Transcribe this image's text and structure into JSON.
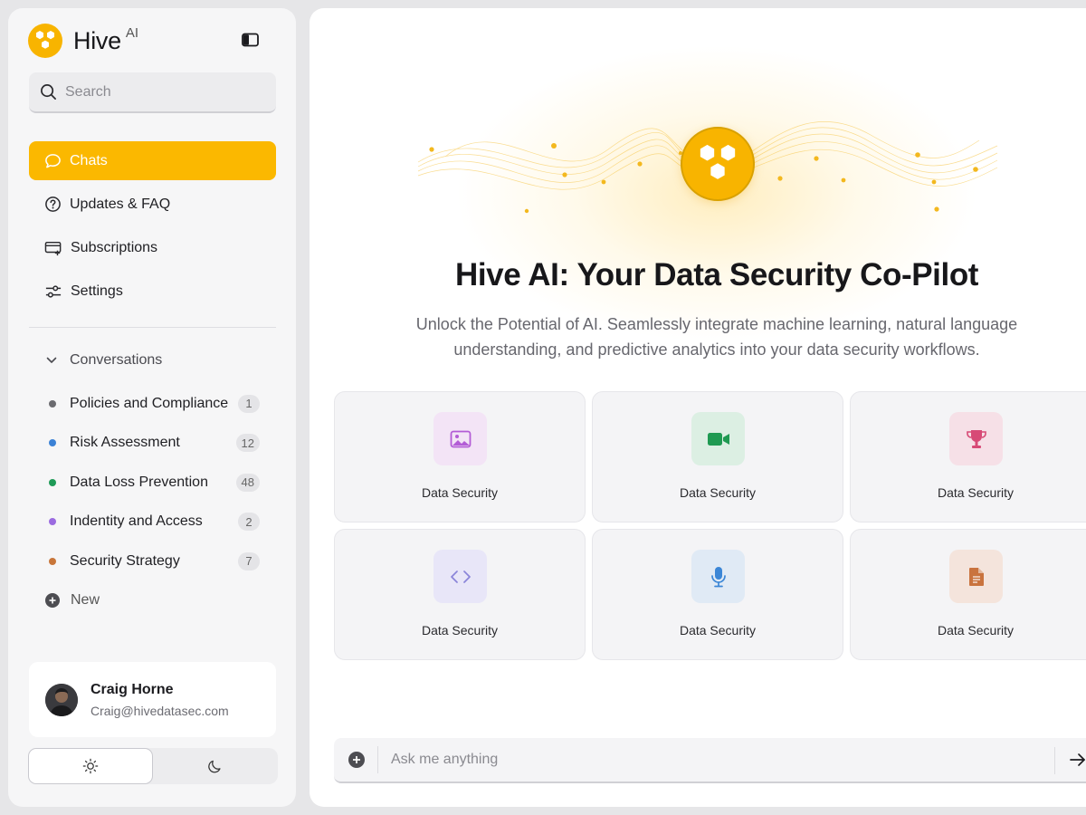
{
  "brand": {
    "name": "Hive",
    "sup": "AI"
  },
  "search": {
    "placeholder": "Search"
  },
  "nav": [
    {
      "label": "Chats",
      "icon": "chat-bubble-icon",
      "active": true
    },
    {
      "label": "Updates & FAQ",
      "icon": "question-circle-icon"
    },
    {
      "label": "Subscriptions",
      "icon": "credit-card-icon"
    },
    {
      "label": "Settings",
      "icon": "sliders-icon"
    }
  ],
  "conversations": {
    "heading": "Conversations",
    "items": [
      {
        "label": "Policies and Compliance",
        "count": "1",
        "color": "#6b6b70"
      },
      {
        "label": "Risk Assessment",
        "count": "12",
        "color": "#3b82d6"
      },
      {
        "label": "Data Loss Prevention",
        "count": "48",
        "color": "#1e9a57"
      },
      {
        "label": "Indentity and Access",
        "count": "2",
        "color": "#9b6be0"
      },
      {
        "label": "Security Strategy",
        "count": "7",
        "color": "#c8763a"
      }
    ],
    "new_label": "New"
  },
  "user": {
    "name": "Craig Horne",
    "email": "Craig@hivedatasec.com"
  },
  "theme": {
    "active": "light"
  },
  "hero": {
    "title": "Hive AI: Your Data Security Co-Pilot",
    "subtitle": "Unlock the Potential of AI. Seamlessly integrate machine learning, natural language understanding, and predictive analytics into your data security workflows."
  },
  "cards": [
    {
      "label": "Data Security",
      "icon": "image-icon",
      "bg": "#f3e4f6",
      "fg": "#b35cd6"
    },
    {
      "label": "Data Security",
      "icon": "video-camera-icon",
      "bg": "#dcefe3",
      "fg": "#1f9a52"
    },
    {
      "label": "Data Security",
      "icon": "trophy-icon",
      "bg": "#f6e0e7",
      "fg": "#d74a76"
    },
    {
      "label": "Data Security",
      "icon": "code-icon",
      "bg": "#e8e6f8",
      "fg": "#8a84d9"
    },
    {
      "label": "Data Security",
      "icon": "microphone-icon",
      "bg": "#e0eaf5",
      "fg": "#3b86d6"
    },
    {
      "label": "Data Security",
      "icon": "document-icon",
      "bg": "#f4e4dc",
      "fg": "#c9733e"
    }
  ],
  "ask": {
    "placeholder": "Ask me anything"
  },
  "colors": {
    "accent": "#fbb800",
    "accent_dark": "#d9a100"
  }
}
